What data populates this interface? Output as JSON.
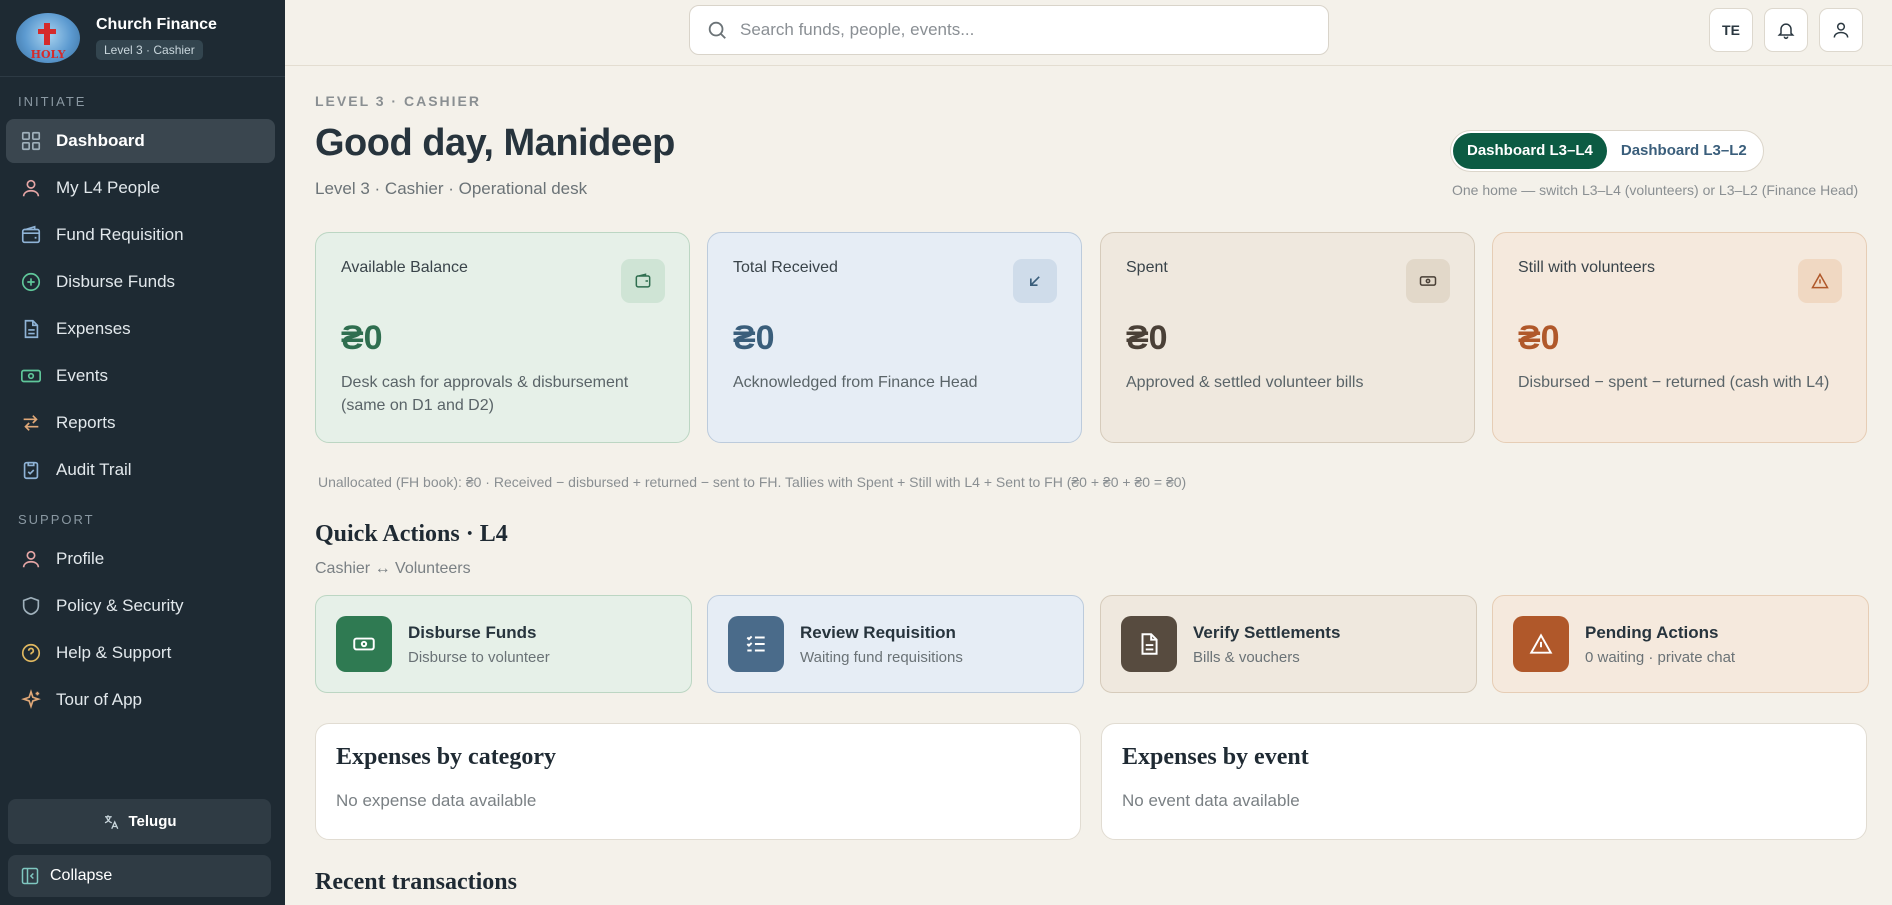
{
  "brand": {
    "name": "Church Finance",
    "badge": "Level 3 · Cashier",
    "logo_text": "HOLY"
  },
  "sidebar": {
    "initiate_label": "INITIATE",
    "initiate_items": [
      {
        "label": "Dashboard",
        "icon": "grid-icon",
        "active": true
      },
      {
        "label": "My L4 People",
        "icon": "user-icon"
      },
      {
        "label": "Fund Requisition",
        "icon": "wallet-icon"
      },
      {
        "label": "Disburse Funds",
        "icon": "plus-circle-icon"
      },
      {
        "label": "Expenses",
        "icon": "document-icon"
      },
      {
        "label": "Events",
        "icon": "banknote-icon"
      },
      {
        "label": "Reports",
        "icon": "arrows-icon"
      },
      {
        "label": "Audit Trail",
        "icon": "clipboard-check-icon"
      }
    ],
    "support_label": "SUPPORT",
    "support_items": [
      {
        "label": "Profile",
        "icon": "user-icon"
      },
      {
        "label": "Policy & Security",
        "icon": "shield-icon"
      },
      {
        "label": "Help & Support",
        "icon": "help-circle-icon"
      },
      {
        "label": "Tour of App",
        "icon": "sparkles-icon"
      }
    ],
    "language_label": "Telugu",
    "collapse_label": "Collapse"
  },
  "topbar": {
    "search_placeholder": "Search funds, people, events...",
    "lang_code": "TE"
  },
  "header": {
    "eyebrow": "LEVEL 3 · CASHIER",
    "greeting": "Good day, Manideep",
    "subline": "Level 3 · Cashier · Operational desk",
    "toggle": [
      "Dashboard L3–L4",
      "Dashboard L3–L2"
    ],
    "toggle_active": 0,
    "toggle_note": "One home — switch L3–L4 (volunteers) or L3–L2 (Finance Head)"
  },
  "stats": [
    {
      "label": "Available Balance",
      "value": "₴0",
      "desc": "Desk cash for approvals & disbursement (same on D1 and D2)",
      "icon": "wallet-icon",
      "accent": "#2f6e4f",
      "bg": "#e6f0e8",
      "border": "#bcd6c3",
      "icon_bg": "#cfe4d5"
    },
    {
      "label": "Total Received",
      "value": "₴0",
      "desc": "Acknowledged from Finance Head",
      "icon": "arrow-down-left-icon",
      "accent": "#3a5e7b",
      "bg": "#e6edf5",
      "border": "#bccbdc",
      "icon_bg": "#cfdcea"
    },
    {
      "label": "Spent",
      "value": "₴0",
      "desc": "Approved & settled volunteer bills",
      "icon": "banknote-icon",
      "accent": "#4a4037",
      "bg": "#efe8de",
      "border": "#d6cbbb",
      "icon_bg": "#e2d8c9"
    },
    {
      "label": "Still with volunteers",
      "value": "₴0",
      "desc": "Disbursed − spent − returned (cash with L4)",
      "icon": "alert-triangle-icon",
      "accent": "#b0582a",
      "bg": "#f5e9dd",
      "border": "#e6cdb5",
      "icon_bg": "#f0d8c2"
    }
  ],
  "tally_note": "Unallocated (FH book): ₴0 · Received − disbursed + returned − sent to FH. Tallies with Spent + Still with L4 + Sent to FH (₴0 + ₴0 + ₴0 = ₴0)",
  "quick_actions": {
    "title": "Quick Actions · L4",
    "subtitle": "Cashier ↔ Volunteers",
    "items": [
      {
        "name": "Disburse Funds",
        "desc": "Disburse to volunteer",
        "icon": "banknote-icon",
        "icon_bg": "#2f7a52",
        "bg": "#e6f0e8",
        "border": "#bcd6c3"
      },
      {
        "name": "Review Requisition",
        "desc": "Waiting fund requisitions",
        "icon": "checklist-icon",
        "icon_bg": "#4a6b8a",
        "bg": "#e6edf5",
        "border": "#bccbdc"
      },
      {
        "name": "Verify Settlements",
        "desc": "Bills & vouchers",
        "icon": "document-icon",
        "icon_bg": "#574b3f",
        "bg": "#efe8de",
        "border": "#d6cbbb"
      },
      {
        "name": "Pending Actions",
        "desc": "0 waiting · private chat",
        "icon": "alert-triangle-icon",
        "icon_bg": "#b0582a",
        "bg": "#f5e9dd",
        "border": "#e6cdb5"
      }
    ]
  },
  "panels": [
    {
      "title": "Expenses by category",
      "empty": "No expense data available"
    },
    {
      "title": "Expenses by event",
      "empty": "No event data available"
    }
  ],
  "recent_title": "Recent transactions"
}
